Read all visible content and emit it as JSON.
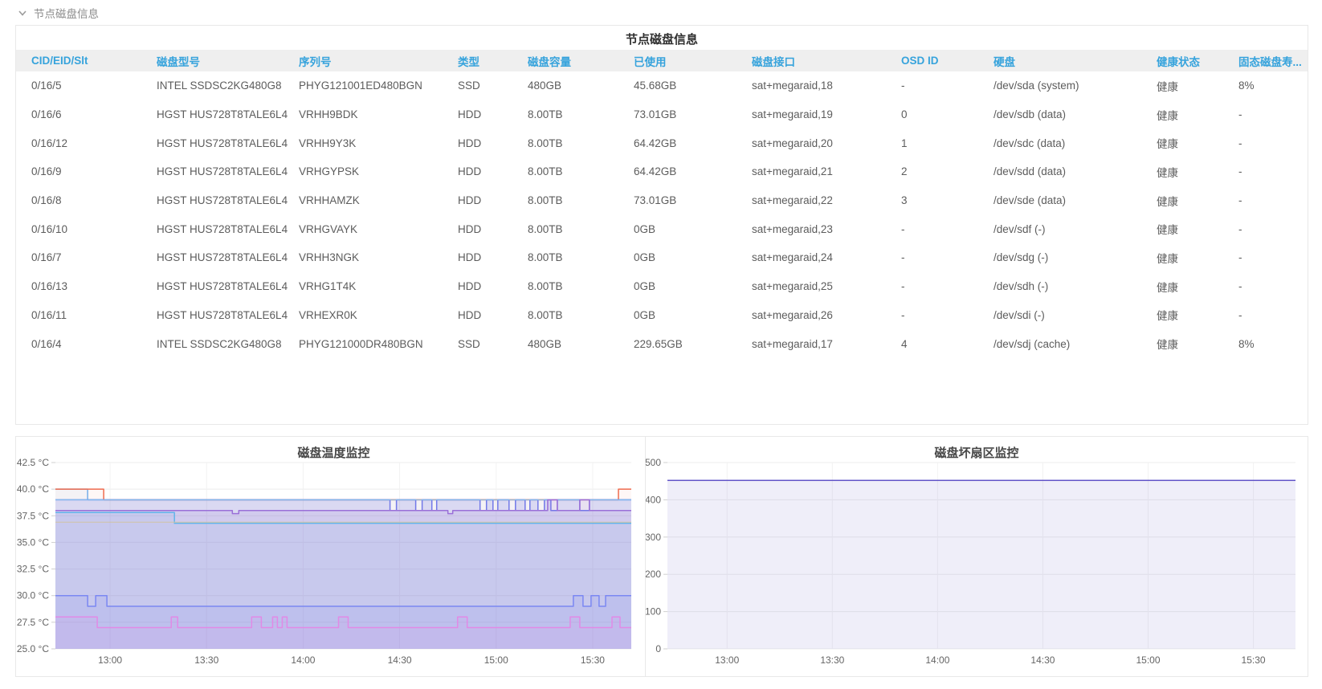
{
  "section": {
    "title": "节点磁盘信息"
  },
  "palette": {
    "header_text": "#36a3dc",
    "header_bg": "#efefef",
    "row_text": "#5c5c5c",
    "panel_border": "#e8e8e8",
    "section_text": "#8c8c8c"
  },
  "table": {
    "title": "节点磁盘信息",
    "columns": [
      "CID/EID/Slt",
      "磁盘型号",
      "序列号",
      "类型",
      "磁盘容量",
      "已使用",
      "磁盘接口",
      "OSD ID",
      "硬盘",
      "健康状态",
      "固态磁盘寿..."
    ],
    "rows": [
      [
        "0/16/5",
        "INTEL SSDSC2KG480G8",
        "PHYG121001ED480BGN",
        "SSD",
        "480GB",
        "45.68GB",
        "sat+megaraid,18",
        "-",
        "/dev/sda (system)",
        "健康",
        "8%"
      ],
      [
        "0/16/6",
        "HGST HUS728T8TALE6L4",
        "VRHH9BDK",
        "HDD",
        "8.00TB",
        "73.01GB",
        "sat+megaraid,19",
        "0",
        "/dev/sdb (data)",
        "健康",
        "-"
      ],
      [
        "0/16/12",
        "HGST HUS728T8TALE6L4",
        "VRHH9Y3K",
        "HDD",
        "8.00TB",
        "64.42GB",
        "sat+megaraid,20",
        "1",
        "/dev/sdc (data)",
        "健康",
        "-"
      ],
      [
        "0/16/9",
        "HGST HUS728T8TALE6L4",
        "VRHGYPSK",
        "HDD",
        "8.00TB",
        "64.42GB",
        "sat+megaraid,21",
        "2",
        "/dev/sdd (data)",
        "健康",
        "-"
      ],
      [
        "0/16/8",
        "HGST HUS728T8TALE6L4",
        "VRHHAMZK",
        "HDD",
        "8.00TB",
        "73.01GB",
        "sat+megaraid,22",
        "3",
        "/dev/sde (data)",
        "健康",
        "-"
      ],
      [
        "0/16/10",
        "HGST HUS728T8TALE6L4",
        "VRHGVAYK",
        "HDD",
        "8.00TB",
        "0GB",
        "sat+megaraid,23",
        "-",
        "/dev/sdf (-)",
        "健康",
        "-"
      ],
      [
        "0/16/7",
        "HGST HUS728T8TALE6L4",
        "VRHH3NGK",
        "HDD",
        "8.00TB",
        "0GB",
        "sat+megaraid,24",
        "-",
        "/dev/sdg (-)",
        "健康",
        "-"
      ],
      [
        "0/16/13",
        "HGST HUS728T8TALE6L4",
        "VRHG1T4K",
        "HDD",
        "8.00TB",
        "0GB",
        "sat+megaraid,25",
        "-",
        "/dev/sdh (-)",
        "健康",
        "-"
      ],
      [
        "0/16/11",
        "HGST HUS728T8TALE6L4",
        "VRHEXR0K",
        "HDD",
        "8.00TB",
        "0GB",
        "sat+megaraid,26",
        "-",
        "/dev/sdi (-)",
        "健康",
        "-"
      ],
      [
        "0/16/4",
        "INTEL SSDSC2KG480G8",
        "PHYG121000DR480BGN",
        "SSD",
        "480GB",
        "229.65GB",
        "sat+megaraid,17",
        "4",
        "/dev/sdj (cache)",
        "健康",
        "8%"
      ]
    ]
  },
  "chart_data": [
    {
      "type": "area",
      "title": "磁盘温度监控",
      "x_range": [
        0,
        179
      ],
      "y_range": [
        25,
        42.5
      ],
      "x_ticks": [
        {
          "t": 17,
          "label": "13:00"
        },
        {
          "t": 47,
          "label": "13:30"
        },
        {
          "t": 77,
          "label": "14:00"
        },
        {
          "t": 107,
          "label": "14:30"
        },
        {
          "t": 137,
          "label": "15:00"
        },
        {
          "t": 167,
          "label": "15:30"
        }
      ],
      "y_ticks": [
        {
          "v": 42.5,
          "label": "42.5 °C"
        },
        {
          "v": 40,
          "label": "40.0 °C"
        },
        {
          "v": 37.5,
          "label": "37.5 °C"
        },
        {
          "v": 35,
          "label": "35.0 °C"
        },
        {
          "v": 32.5,
          "label": "32.5 °C"
        },
        {
          "v": 30,
          "label": "30.0 °C"
        },
        {
          "v": 27.5,
          "label": "27.5 °C"
        },
        {
          "v": 25,
          "label": "25.0 °C"
        }
      ],
      "grid": true,
      "legend": "none",
      "series": [
        {
          "name": "disk-temp-40-blue",
          "color": "#6db3f2",
          "fill": "rgba(109,179,242,0.07)",
          "points": [
            [
              0,
              40
            ],
            [
              10,
              40
            ],
            [
              10,
              39
            ],
            [
              179,
              39
            ]
          ]
        },
        {
          "name": "disk-temp-40-orange",
          "color": "#ef6b4d",
          "fill": "rgba(239,107,77,0.05)",
          "points": [
            [
              0,
              40
            ],
            [
              15,
              40
            ],
            [
              15,
              39
            ],
            [
              175,
              39
            ],
            [
              175,
              40
            ],
            [
              179,
              40
            ]
          ]
        },
        {
          "name": "disk-temp-39-band",
          "color": "#7278e8",
          "fill": "rgba(114,120,232,0.20)",
          "points": [
            [
              0,
              39
            ],
            [
              104,
              39
            ],
            [
              104,
              38
            ],
            [
              106,
              38
            ],
            [
              106,
              39
            ],
            [
              112,
              39
            ],
            [
              112,
              38
            ],
            [
              114,
              38
            ],
            [
              114,
              39
            ],
            [
              117,
              39
            ],
            [
              117,
              38
            ],
            [
              118.5,
              38
            ],
            [
              118.5,
              39
            ],
            [
              132,
              39
            ],
            [
              132,
              38
            ],
            [
              134,
              38
            ],
            [
              134,
              39
            ],
            [
              136,
              39
            ],
            [
              136,
              38
            ],
            [
              137.5,
              38
            ],
            [
              137.5,
              39
            ],
            [
              141,
              39
            ],
            [
              141,
              38
            ],
            [
              143,
              38
            ],
            [
              143,
              39
            ],
            [
              146,
              39
            ],
            [
              146,
              38
            ],
            [
              147.5,
              38
            ],
            [
              147.5,
              39
            ],
            [
              150,
              39
            ],
            [
              150,
              38
            ],
            [
              152,
              38
            ],
            [
              152,
              39
            ],
            [
              154,
              39
            ],
            [
              154,
              38
            ],
            [
              156,
              38
            ],
            [
              156,
              39
            ],
            [
              163,
              39
            ],
            [
              163,
              38
            ],
            [
              166,
              38
            ],
            [
              166,
              39
            ],
            [
              179,
              39
            ]
          ]
        },
        {
          "name": "disk-temp-39-cyan",
          "color": "#85c8f0",
          "width": 1,
          "points": [
            [
              0,
              39
            ],
            [
              179,
              39
            ]
          ]
        },
        {
          "name": "disk-temp-38-purple",
          "color": "#9a6fd8",
          "fill": "rgba(154,111,216,0.13)",
          "points": [
            [
              0,
              38
            ],
            [
              55,
              38
            ],
            [
              55,
              37.7
            ],
            [
              57,
              37.7
            ],
            [
              57,
              38
            ],
            [
              122,
              38
            ],
            [
              122,
              37.7
            ],
            [
              123.5,
              37.7
            ],
            [
              123.5,
              38
            ],
            [
              153,
              38
            ],
            [
              153,
              39
            ],
            [
              156,
              39
            ],
            [
              156,
              38
            ],
            [
              163,
              38
            ],
            [
              163,
              39
            ],
            [
              166,
              39
            ],
            [
              166,
              38
            ],
            [
              179,
              38
            ]
          ]
        },
        {
          "name": "disk-temp-37-cyan",
          "color": "#62b4ea",
          "fill": "rgba(98,180,234,0.08)",
          "points": [
            [
              0,
              37.8
            ],
            [
              37,
              37.8
            ],
            [
              37,
              36.8
            ],
            [
              179,
              36.8
            ]
          ]
        },
        {
          "name": "disk-temp-37-tan",
          "color": "#cfc3a4",
          "width": 1,
          "points": [
            [
              0,
              36.9
            ],
            [
              179,
              36.9
            ]
          ]
        },
        {
          "name": "disk-temp-30-blue",
          "color": "#7b87f2",
          "fill": "rgba(123,135,242,0.12)",
          "points": [
            [
              0,
              30
            ],
            [
              10,
              30
            ],
            [
              10,
              29
            ],
            [
              12.5,
              29
            ],
            [
              12.5,
              30
            ],
            [
              16,
              30
            ],
            [
              16,
              29
            ],
            [
              161,
              29
            ],
            [
              161,
              30
            ],
            [
              164,
              30
            ],
            [
              164,
              29
            ],
            [
              166.5,
              29
            ],
            [
              166.5,
              30
            ],
            [
              169,
              30
            ],
            [
              169,
              29
            ],
            [
              171,
              29
            ],
            [
              171,
              30
            ],
            [
              179,
              30
            ]
          ]
        },
        {
          "name": "disk-temp-27-magenta",
          "color": "#e18ae6",
          "fill": "rgba(225,138,230,0.11)",
          "points": [
            [
              0,
              28
            ],
            [
              13,
              28
            ],
            [
              13,
              27
            ],
            [
              36,
              27
            ],
            [
              36,
              28
            ],
            [
              38,
              28
            ],
            [
              38,
              27
            ],
            [
              61,
              27
            ],
            [
              61,
              28
            ],
            [
              64,
              28
            ],
            [
              64,
              27
            ],
            [
              67.5,
              27
            ],
            [
              67.5,
              28
            ],
            [
              69,
              28
            ],
            [
              69,
              27
            ],
            [
              70.5,
              27
            ],
            [
              70.5,
              28
            ],
            [
              72,
              28
            ],
            [
              72,
              27
            ],
            [
              88,
              27
            ],
            [
              88,
              28
            ],
            [
              91,
              28
            ],
            [
              91,
              27
            ],
            [
              125,
              27
            ],
            [
              125,
              28
            ],
            [
              128,
              28
            ],
            [
              128,
              27
            ],
            [
              160,
              27
            ],
            [
              160,
              28
            ],
            [
              163,
              28
            ],
            [
              163,
              27
            ],
            [
              173,
              27
            ],
            [
              173,
              28
            ],
            [
              175.5,
              28
            ],
            [
              175.5,
              27
            ],
            [
              179,
              27
            ]
          ]
        }
      ]
    },
    {
      "type": "area",
      "title": "磁盘坏扇区监控",
      "x_range": [
        0,
        179
      ],
      "y_range": [
        0,
        500
      ],
      "x_ticks": [
        {
          "t": 17,
          "label": "13:00"
        },
        {
          "t": 47,
          "label": "13:30"
        },
        {
          "t": 77,
          "label": "14:00"
        },
        {
          "t": 107,
          "label": "14:30"
        },
        {
          "t": 137,
          "label": "15:00"
        },
        {
          "t": 167,
          "label": "15:30"
        }
      ],
      "y_ticks": [
        {
          "v": 500,
          "label": "500"
        },
        {
          "v": 400,
          "label": "400"
        },
        {
          "v": 300,
          "label": "300"
        },
        {
          "v": 200,
          "label": "200"
        },
        {
          "v": 100,
          "label": "100"
        },
        {
          "v": 0,
          "label": "0"
        }
      ],
      "grid": true,
      "legend": "none",
      "series": [
        {
          "name": "bad-sector-count",
          "color": "#6254c8",
          "fill": "rgba(98,84,200,0.10)",
          "points": [
            [
              0,
              452
            ],
            [
              179,
              452
            ]
          ]
        }
      ]
    }
  ]
}
